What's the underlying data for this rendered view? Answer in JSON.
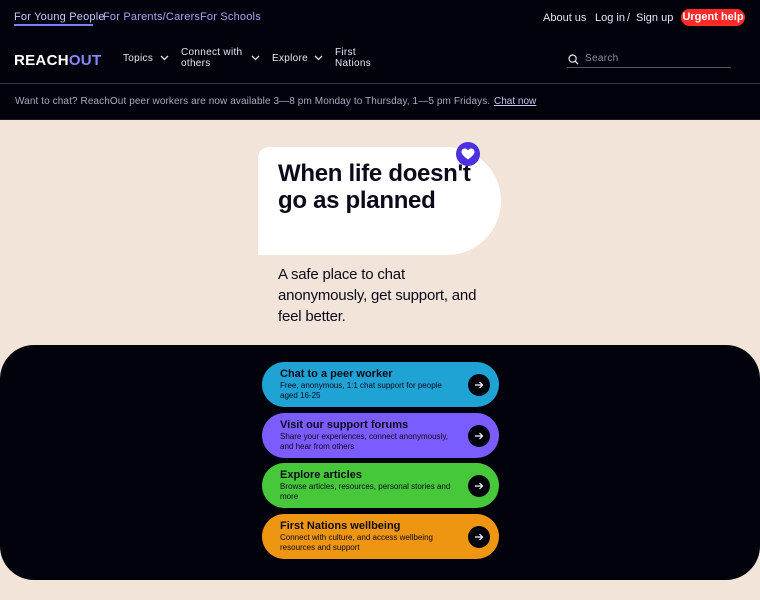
{
  "audience_nav": [
    {
      "label": "For Young People",
      "active": true
    },
    {
      "label": "For Parents/Carers",
      "active": false
    },
    {
      "label": "For Schools",
      "active": false
    }
  ],
  "utility": {
    "about": "About us",
    "login": "Log in",
    "separator": "/",
    "signup": "Sign up",
    "urgent": "Urgent help"
  },
  "brand": {
    "part1": "REACH",
    "part2": "OUT"
  },
  "main_nav": [
    {
      "label": "Topics",
      "has_dropdown": true
    },
    {
      "label": "Connect with others",
      "has_dropdown": true
    },
    {
      "label": "Explore",
      "has_dropdown": true
    },
    {
      "label": "First Nations",
      "has_dropdown": false
    }
  ],
  "search": {
    "placeholder": "Search"
  },
  "announcement": {
    "text": "Want to chat? ReachOut peer workers are now available 3—8 pm Monday to Thursday, 1—5 pm Fridays.",
    "link": "Chat now"
  },
  "hero": {
    "title": "When life doesn't go as planned",
    "subtitle": "A safe place to chat anonymously, get support, and feel better."
  },
  "cards": [
    {
      "title": "Chat to a peer worker",
      "desc": "Free, anonymous, 1:1 chat support for people aged 16-25",
      "color": "#1fa3d4"
    },
    {
      "title": "Visit our support forums",
      "desc": "Share your experiences, connect anonymously, and hear from others",
      "color": "#7b5cff"
    },
    {
      "title": "Explore articles",
      "desc": "Browse articles, resources, personal stories and more",
      "color": "#46c83a"
    },
    {
      "title": "First Nations wellbeing",
      "desc": "Connect with culture, and access wellbeing resources and support",
      "color": "#ee9612"
    }
  ],
  "colors": {
    "background": "#f2e4d9",
    "dark": "#02020c",
    "accent": "#4b2fe0",
    "urgent": "#ff2a2a"
  }
}
